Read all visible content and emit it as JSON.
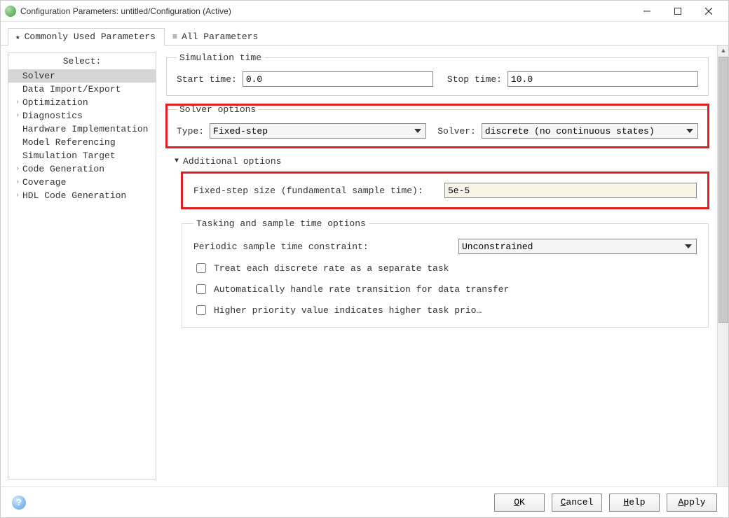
{
  "window": {
    "title": "Configuration Parameters: untitled/Configuration (Active)"
  },
  "tabs": {
    "commonly_used": "Commonly Used Parameters",
    "all_params": "All Parameters"
  },
  "sidebar": {
    "heading": "Select:",
    "items": [
      {
        "label": "Solver",
        "expandable": false,
        "selected": true
      },
      {
        "label": "Data Import/Export",
        "expandable": false
      },
      {
        "label": "Optimization",
        "expandable": true
      },
      {
        "label": "Diagnostics",
        "expandable": true
      },
      {
        "label": "Hardware Implementation",
        "expandable": false
      },
      {
        "label": "Model Referencing",
        "expandable": false
      },
      {
        "label": "Simulation Target",
        "expandable": false
      },
      {
        "label": "Code Generation",
        "expandable": true
      },
      {
        "label": "Coverage",
        "expandable": true
      },
      {
        "label": "HDL Code Generation",
        "expandable": true
      }
    ]
  },
  "simulation_time": {
    "legend": "Simulation time",
    "start_label": "Start time:",
    "start_value": "0.0",
    "stop_label": "Stop time:",
    "stop_value": "10.0"
  },
  "solver_options": {
    "legend": "Solver options",
    "type_label": "Type:",
    "type_value": "Fixed-step",
    "solver_label": "Solver:",
    "solver_value": "discrete (no continuous states)"
  },
  "additional": {
    "heading": "Additional options",
    "fixed_step_label": "Fixed-step size (fundamental sample time):",
    "fixed_step_value": "5e-5"
  },
  "tasking": {
    "legend": "Tasking and sample time options",
    "periodic_label": "Periodic sample time constraint:",
    "periodic_value": "Unconstrained",
    "check1": "Treat each discrete rate as a separate task",
    "check2": "Automatically handle rate transition for data transfer",
    "check3": "Higher priority value indicates higher task prio…"
  },
  "buttons": {
    "ok": "OK",
    "cancel": "Cancel",
    "help": "Help",
    "apply": "Apply"
  }
}
